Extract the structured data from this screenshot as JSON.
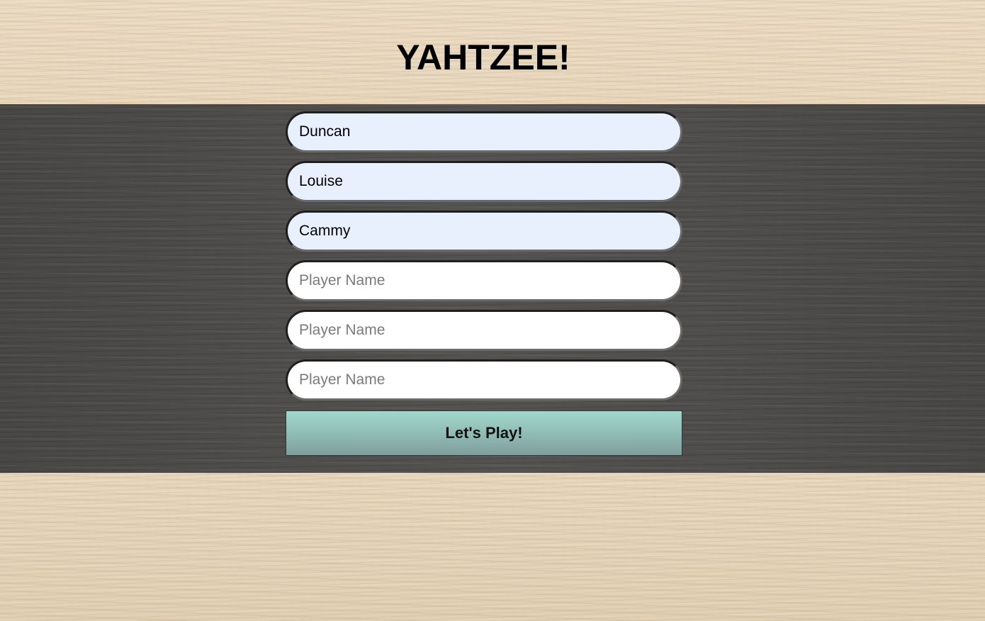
{
  "header": {
    "title": "YAHTZEE!"
  },
  "form": {
    "players": [
      {
        "value": "Duncan",
        "placeholder": "Player Name"
      },
      {
        "value": "Louise",
        "placeholder": "Player Name"
      },
      {
        "value": "Cammy",
        "placeholder": "Player Name"
      },
      {
        "value": "",
        "placeholder": "Player Name"
      },
      {
        "value": "",
        "placeholder": "Player Name"
      },
      {
        "value": "",
        "placeholder": "Player Name"
      }
    ],
    "submit_label": "Let's Play!"
  },
  "colors": {
    "band": "#4f4d4b",
    "autofill_input": "#e8f0fe",
    "button_top": "#a2d7cb",
    "button_bottom": "#7f9e9c"
  }
}
